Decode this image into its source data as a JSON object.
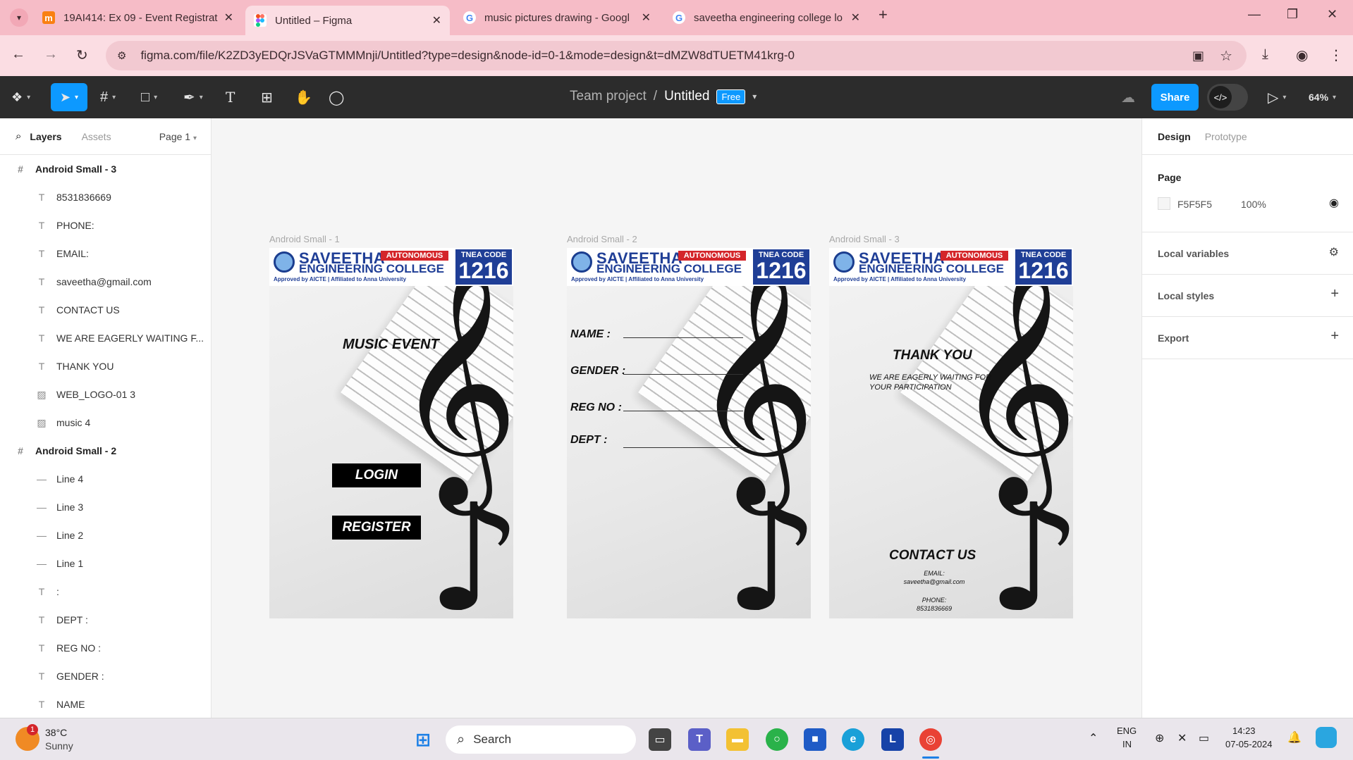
{
  "browser": {
    "tabs": [
      {
        "title": "19AI414: Ex 09 - Event Registrat",
        "favicon": "moodle-icon",
        "active": false
      },
      {
        "title": "Untitled – Figma",
        "favicon": "figma-icon",
        "active": true
      },
      {
        "title": "music pictures drawing - Googl",
        "favicon": "google-icon",
        "active": false
      },
      {
        "title": "saveetha engineering college lo",
        "favicon": "google-icon",
        "active": false
      }
    ],
    "new_tab": "+",
    "url": "figma.com/file/K2ZD3yEDQrJSVaGTMMMnji/Untitled?type=design&node-id=0-1&mode=design&t=dMZW8dTUETM41krg-0"
  },
  "figma": {
    "team": "Team project",
    "separator": "/",
    "file": "Untitled",
    "plan_badge": "Free",
    "share_label": "Share",
    "zoom": "64%",
    "left_panel": {
      "tab_layers": "Layers",
      "tab_assets": "Assets",
      "page_select": "Page 1",
      "layers": [
        {
          "label": "Android Small - 3",
          "kind": "frame"
        },
        {
          "label": "8531836669",
          "kind": "text"
        },
        {
          "label": "PHONE:",
          "kind": "text"
        },
        {
          "label": "EMAIL:",
          "kind": "text"
        },
        {
          "label": "saveetha@gmail.com",
          "kind": "text"
        },
        {
          "label": "CONTACT US",
          "kind": "text"
        },
        {
          "label": "WE ARE EAGERLY WAITING F...",
          "kind": "text"
        },
        {
          "label": "THANK YOU",
          "kind": "text"
        },
        {
          "label": "WEB_LOGO-01 3",
          "kind": "image"
        },
        {
          "label": "music 4",
          "kind": "image"
        },
        {
          "label": "Android Small - 2",
          "kind": "frame"
        },
        {
          "label": "Line 4",
          "kind": "line"
        },
        {
          "label": "Line 3",
          "kind": "line"
        },
        {
          "label": "Line 2",
          "kind": "line"
        },
        {
          "label": "Line 1",
          "kind": "line"
        },
        {
          "label": ":",
          "kind": "text"
        },
        {
          "label": "DEPT :",
          "kind": "text"
        },
        {
          "label": "REG NO :",
          "kind": "text"
        },
        {
          "label": "GENDER :",
          "kind": "text"
        },
        {
          "label": "NAME",
          "kind": "text"
        }
      ]
    },
    "right_panel": {
      "tab_design": "Design",
      "tab_prototype": "Prototype",
      "page_heading": "Page",
      "page_color": "F5F5F5",
      "page_opacity": "100%",
      "local_variables": "Local variables",
      "local_styles": "Local styles",
      "export": "Export"
    },
    "help": "?"
  },
  "frames": {
    "f1": {
      "label": "Android Small - 1",
      "title": "MUSIC EVENT",
      "login": "LOGIN",
      "register": "REGISTER"
    },
    "f2": {
      "label": "Android Small - 2",
      "name": "NAME  :",
      "gender": "GENDER :",
      "regno": "REG NO :",
      "dept": "DEPT :"
    },
    "f3": {
      "label": "Android Small - 3",
      "thank": "THANK YOU",
      "waiting1": "WE ARE EAGERLY WAITING FOR",
      "waiting2": "YOUR PARTICIPATION",
      "contact": "CONTACT US",
      "email_label": "EMAIL:",
      "email": "saveetha@gmail.com",
      "phone_label": "PHONE:",
      "phone": "8531836669"
    },
    "logo": {
      "line1": "SAVEETHA",
      "line2": "ENGINEERING COLLEGE",
      "badge": "AUTONOMOUS",
      "approved": "Approved by AICTE  |  Affiliated to Anna University",
      "tnea_label": "TNEA CODE",
      "tnea_code": "1216"
    }
  },
  "taskbar": {
    "weather_temp": "38°C",
    "weather_desc": "Sunny",
    "weather_alert": "1",
    "search": "Search",
    "lang1": "ENG",
    "lang2": "IN",
    "time": "14:23",
    "date": "07-05-2024"
  }
}
